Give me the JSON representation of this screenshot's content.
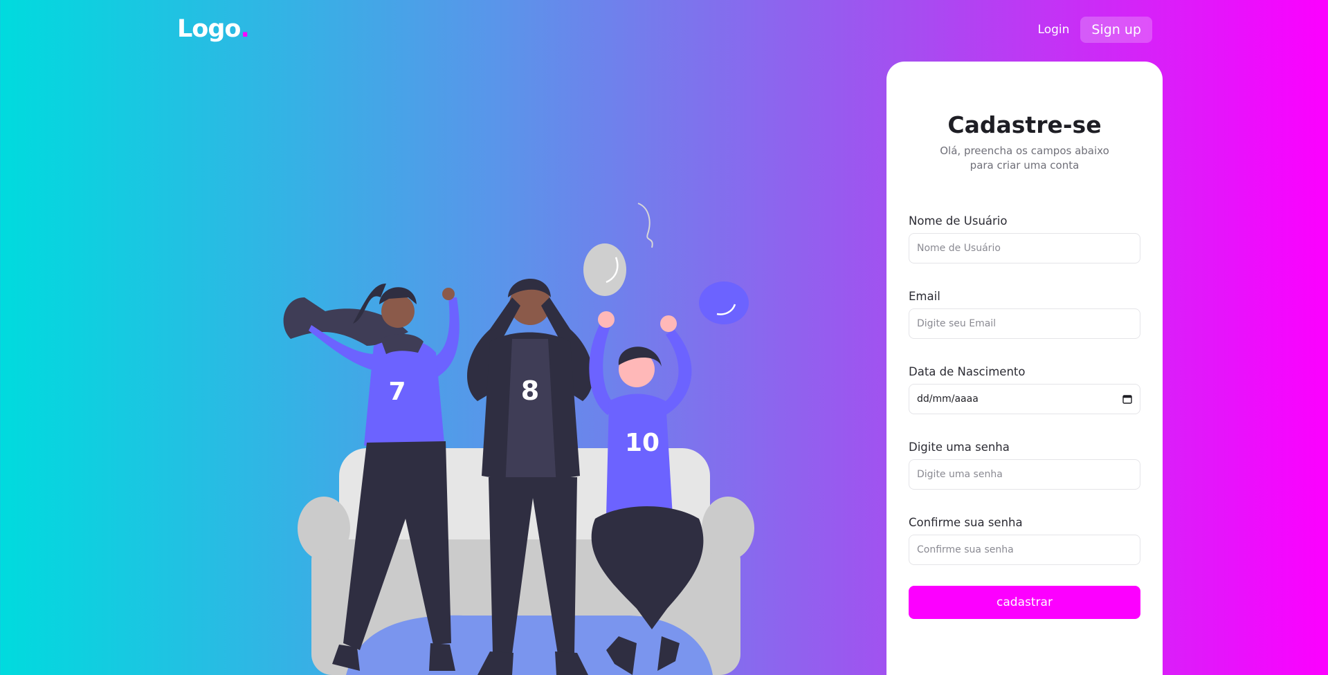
{
  "header": {
    "logo_text": "Logo",
    "logo_dot": ".",
    "login_label": "Login",
    "signup_label": "Sign up"
  },
  "illustration": {
    "jersey_numbers": [
      "7",
      "8",
      "10"
    ]
  },
  "form": {
    "title": "Cadastre-se",
    "subtitle": "Olá, preencha os campos abaixo para criar uma conta",
    "fields": [
      {
        "label": "Nome de Usuário",
        "placeholder": "Nome de Usuário"
      },
      {
        "label": "Email",
        "placeholder": "Digite seu Email"
      },
      {
        "label": "Data de Nascimento",
        "value": "dd/mm/aaaa"
      },
      {
        "label": "Digite uma senha",
        "placeholder": "Digite uma senha"
      },
      {
        "label": "Confirme sua senha",
        "placeholder": "Confirme sua senha"
      }
    ],
    "submit_label": "cadastrar"
  },
  "colors": {
    "accent": "#fc00ff",
    "gradient_start": "#00dbde",
    "gradient_end": "#fc00ff"
  }
}
